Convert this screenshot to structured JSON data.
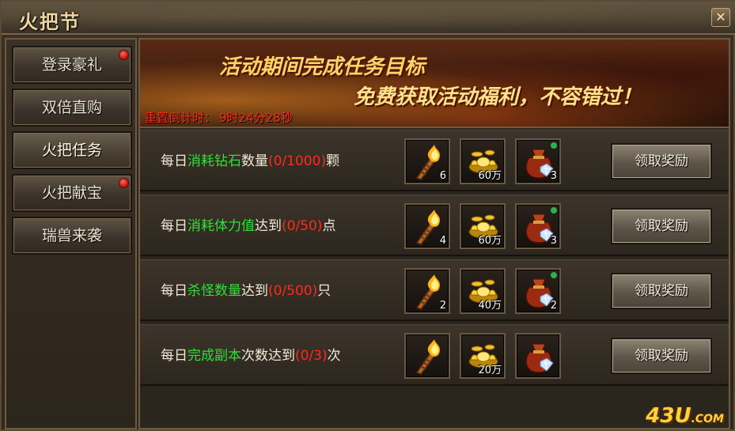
{
  "window": {
    "title": "火把节",
    "close_glyph": "✕"
  },
  "sidebar": {
    "items": [
      {
        "label": "登录豪礼",
        "red_dot": true
      },
      {
        "label": "双倍直购",
        "red_dot": false
      },
      {
        "label": "火把任务",
        "red_dot": false,
        "active": true
      },
      {
        "label": "火把献宝",
        "red_dot": true
      },
      {
        "label": "瑞兽来袭",
        "red_dot": false
      }
    ]
  },
  "banner": {
    "line1": "活动期间完成任务目标",
    "line2": "免费获取活动福利，不容错过！",
    "countdown_label": "重置倒计时：",
    "countdown_value": "9时24分28秒"
  },
  "tasks": [
    {
      "pre": "每日",
      "key": "消耗钻石",
      "mid": "数量",
      "progress": "(0/1000)",
      "post": "颗",
      "rewards": [
        {
          "icon": "torch-icon",
          "count": "6"
        },
        {
          "icon": "gold-ingot-icon",
          "count": "60万"
        },
        {
          "icon": "treasure-bag-icon",
          "count": "3",
          "green_dot": true
        }
      ],
      "button": "领取奖励"
    },
    {
      "pre": "每日",
      "key": "消耗体力值",
      "mid": "达到",
      "progress": "(0/50)",
      "post": "点",
      "rewards": [
        {
          "icon": "torch-icon",
          "count": "4"
        },
        {
          "icon": "gold-ingot-icon",
          "count": "60万"
        },
        {
          "icon": "treasure-bag-icon",
          "count": "3",
          "green_dot": true
        }
      ],
      "button": "领取奖励"
    },
    {
      "pre": "每日",
      "key": "杀怪数量",
      "mid": "达到",
      "progress": "(0/500)",
      "post": "只",
      "rewards": [
        {
          "icon": "torch-icon",
          "count": "2"
        },
        {
          "icon": "gold-ingot-icon",
          "count": "40万"
        },
        {
          "icon": "treasure-bag-icon",
          "count": "2",
          "green_dot": true
        }
      ],
      "button": "领取奖励"
    },
    {
      "pre": "每日",
      "key": "完成副本",
      "mid": "次数达到",
      "progress": "(0/3)",
      "post": "次",
      "rewards": [
        {
          "icon": "torch-icon",
          "count": ""
        },
        {
          "icon": "gold-ingot-icon",
          "count": "20万"
        },
        {
          "icon": "treasure-bag-icon",
          "count": "",
          "green_dot": false
        }
      ],
      "button": "领取奖励"
    }
  ],
  "watermark": {
    "main": "43U",
    "sub": ".COM"
  }
}
